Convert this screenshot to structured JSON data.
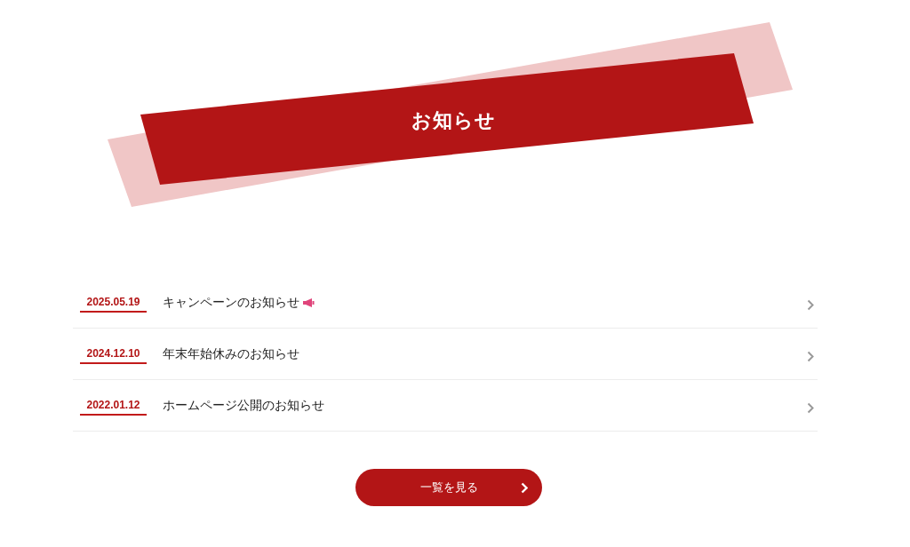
{
  "heading": "お知らせ",
  "news": [
    {
      "date": "2025.05.19",
      "title": "キャンペーンのお知らせ",
      "has_icon": true
    },
    {
      "date": "2024.12.10",
      "title": "年末年始休みのお知らせ",
      "has_icon": false
    },
    {
      "date": "2022.01.12",
      "title": "ホームページ公開のお知らせ",
      "has_icon": false
    }
  ],
  "more_button": "一覧を見る"
}
